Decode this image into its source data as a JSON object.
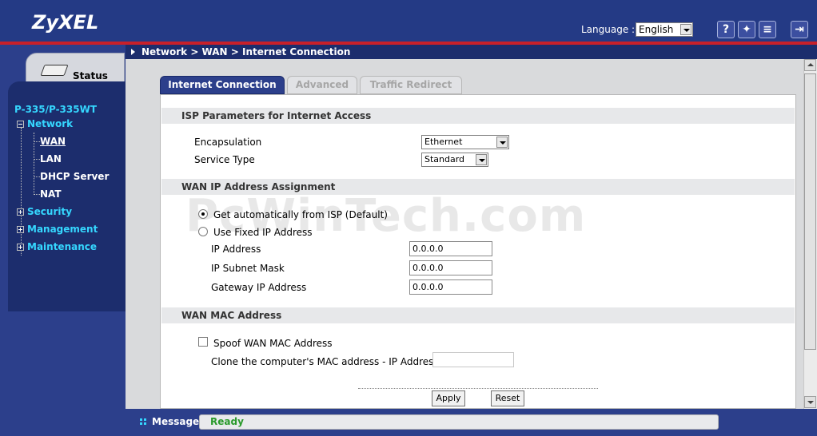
{
  "header": {
    "logo": "ZyXEL",
    "language_label": "Language :",
    "language_value": "English",
    "icons": [
      "help-icon",
      "wizard-icon",
      "sitemap-icon",
      "logout-icon"
    ]
  },
  "sidebar": {
    "status_label": "Status",
    "device_name": "P-335/P-335WT",
    "items": [
      {
        "label": "Network",
        "expanded": true,
        "children": [
          "WAN",
          "LAN",
          "DHCP Server",
          "NAT"
        ]
      },
      {
        "label": "Security",
        "expanded": false
      },
      {
        "label": "Management",
        "expanded": false
      },
      {
        "label": "Maintenance",
        "expanded": false
      }
    ]
  },
  "breadcrumb": "Network > WAN > Internet Connection",
  "tabs": [
    {
      "label": "Internet Connection",
      "active": true
    },
    {
      "label": "Advanced",
      "active": false
    },
    {
      "label": "Traffic Redirect",
      "active": false
    }
  ],
  "isp": {
    "heading": "ISP Parameters for Internet Access",
    "encapsulation_label": "Encapsulation",
    "encapsulation_value": "Ethernet",
    "service_type_label": "Service Type",
    "service_type_value": "Standard"
  },
  "wan_ip": {
    "heading": "WAN IP Address Assignment",
    "auto_label": "Get automatically from ISP (Default)",
    "fixed_label": "Use Fixed IP Address",
    "ip_label": "IP Address",
    "ip_value": "0.0.0.0",
    "mask_label": "IP Subnet Mask",
    "mask_value": "0.0.0.0",
    "gateway_label": "Gateway IP Address",
    "gateway_value": "0.0.0.0"
  },
  "wan_mac": {
    "heading": "WAN MAC Address",
    "spoof_label": "Spoof WAN MAC Address",
    "clone_label": "Clone the computer's MAC address - IP Address"
  },
  "buttons": {
    "apply": "Apply",
    "reset": "Reset"
  },
  "status_bar": {
    "label": "Message",
    "text": "Ready"
  },
  "watermark": "PcWinTech.com",
  "colors": {
    "header": "#243a85",
    "accent_red": "#c8202a",
    "nav_text": "#35d7ff",
    "ready_text": "#2a9a2a"
  }
}
